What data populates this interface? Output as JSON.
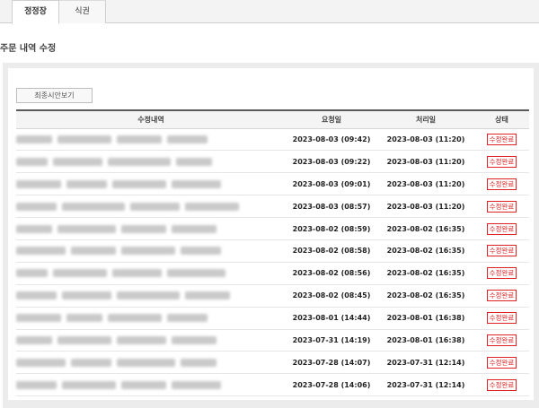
{
  "tabs": [
    {
      "label": "정정장"
    },
    {
      "label": "식권"
    }
  ],
  "page_title": "주문 내역 수정",
  "history_button_label": "최종시안보기",
  "table": {
    "headers": [
      "수정내역",
      "요청일",
      "처리일",
      "상태"
    ],
    "rows": [
      {
        "requested": "2023-08-03 (09:42)",
        "processed": "2023-08-03 (11:20)",
        "status": "수정완료"
      },
      {
        "requested": "2023-08-03 (09:22)",
        "processed": "2023-08-03 (11:20)",
        "status": "수정완료"
      },
      {
        "requested": "2023-08-03 (09:01)",
        "processed": "2023-08-03 (11:20)",
        "status": "수정완료"
      },
      {
        "requested": "2023-08-03 (08:57)",
        "processed": "2023-08-03 (11:20)",
        "status": "수정완료"
      },
      {
        "requested": "2023-08-02 (08:59)",
        "processed": "2023-08-02 (16:35)",
        "status": "수정완료"
      },
      {
        "requested": "2023-08-02 (08:58)",
        "processed": "2023-08-02 (16:35)",
        "status": "수정완료"
      },
      {
        "requested": "2023-08-02 (08:56)",
        "processed": "2023-08-02 (16:35)",
        "status": "수정완료"
      },
      {
        "requested": "2023-08-02 (08:45)",
        "processed": "2023-08-02 (16:35)",
        "status": "수정완료"
      },
      {
        "requested": "2023-08-01 (14:44)",
        "processed": "2023-08-01 (16:38)",
        "status": "수정완료"
      },
      {
        "requested": "2023-07-31 (14:19)",
        "processed": "2023-08-01 (16:38)",
        "status": "수정완료"
      },
      {
        "requested": "2023-07-28 (14:07)",
        "processed": "2023-07-31 (12:14)",
        "status": "수정완료"
      },
      {
        "requested": "2023-07-28 (14:06)",
        "processed": "2023-07-31 (12:14)",
        "status": "수정완료"
      }
    ]
  },
  "colors": {
    "status_red": "#e02222",
    "header_border": "#5a5a5a"
  }
}
